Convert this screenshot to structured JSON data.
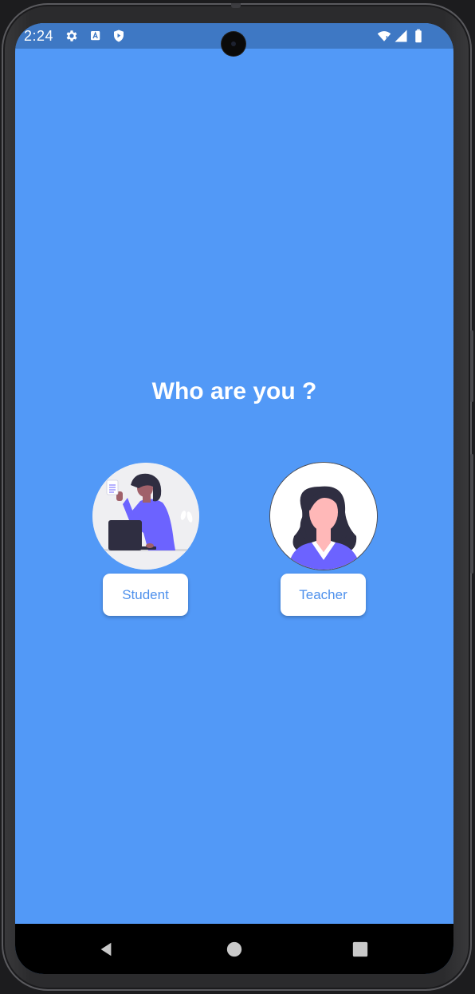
{
  "status_bar": {
    "time": "2:24",
    "icons": [
      "gear-icon",
      "a-badge-icon",
      "shield-play-icon",
      "wifi-icon",
      "signal-icon",
      "battery-icon"
    ],
    "color": "#3e78c4"
  },
  "screen": {
    "background": "#5299f7",
    "title": "Who are you ?"
  },
  "roles": [
    {
      "label": "Student",
      "illustration": "student-illustration"
    },
    {
      "label": "Teacher",
      "illustration": "teacher-illustration"
    }
  ],
  "nav_bar": {
    "items": [
      "back-icon",
      "home-icon",
      "recents-icon"
    ]
  },
  "colors": {
    "button_text": "#4f91ec",
    "accent_purple": "#6c63ff"
  }
}
